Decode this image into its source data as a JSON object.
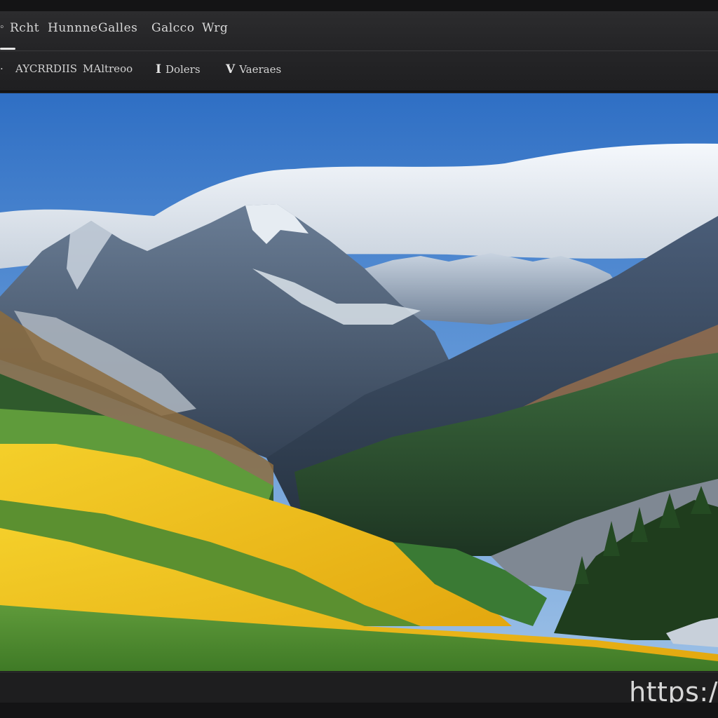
{
  "menubar": {
    "app_icon": "app-icon",
    "items": [
      {
        "label": "Rcht"
      },
      {
        "label": "Hunnne"
      },
      {
        "label": "Galles"
      },
      {
        "label": "Galcco"
      },
      {
        "label": "Wrg"
      }
    ]
  },
  "toolbar": {
    "items": [
      {
        "icon": "",
        "label": "AYCRRDIIS"
      },
      {
        "icon": "",
        "label": "MAltreoo"
      },
      {
        "icon": "I",
        "label": "Dolers"
      },
      {
        "icon": "V",
        "label": "Vaeraes"
      }
    ]
  },
  "viewer": {
    "image_description_name": "landscape-photo"
  },
  "statusbar": {
    "watermark": "https:/"
  }
}
